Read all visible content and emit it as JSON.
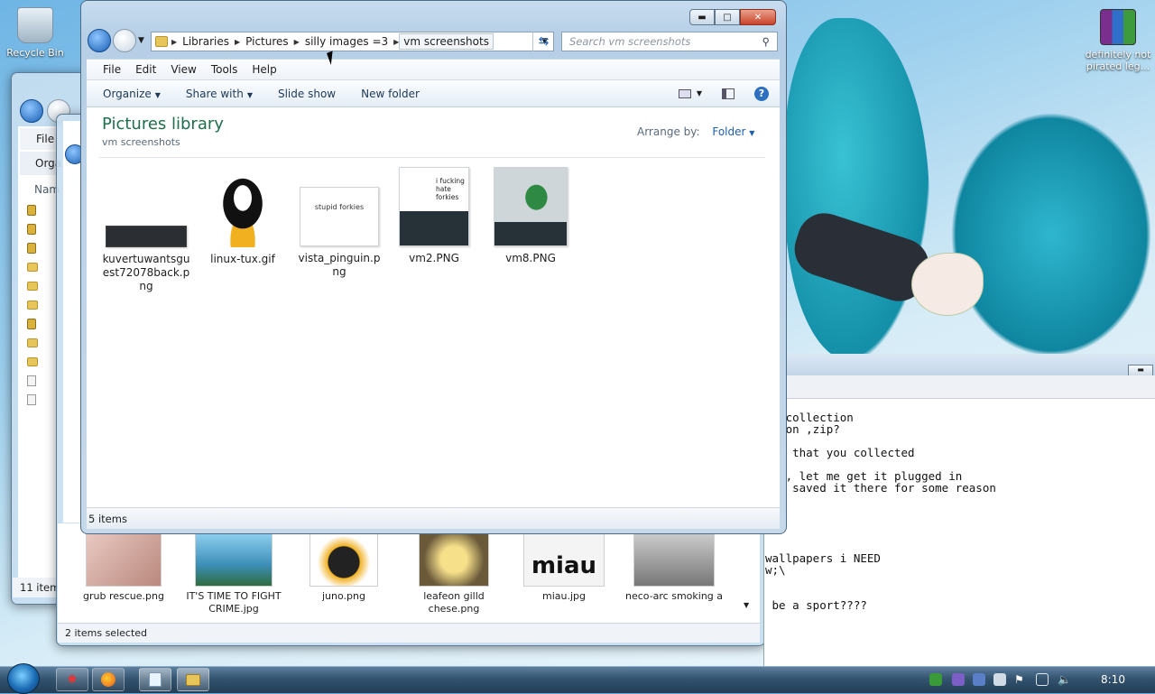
{
  "desktop": {
    "icons": [
      {
        "label": "Recycle Bin"
      },
      {
        "label": "definitely not pirated leg..."
      }
    ]
  },
  "front_window": {
    "breadcrumb": [
      "Libraries",
      "Pictures",
      "silly images =3",
      "vm screenshots"
    ],
    "search_placeholder": "Search vm screenshots",
    "menu": [
      "File",
      "Edit",
      "View",
      "Tools",
      "Help"
    ],
    "toolbar": [
      "Organize",
      "Share with",
      "Slide show",
      "New folder"
    ],
    "library_title": "Pictures library",
    "library_subtitle": "vm screenshots",
    "arrange_label": "Arrange by:",
    "arrange_value": "Folder",
    "files": [
      {
        "name": "kuvertuwantsguest72078back.png"
      },
      {
        "name": "linux-tux.gif"
      },
      {
        "name": "vista_pinguin.png"
      },
      {
        "name": "vm2.PNG",
        "thumb_text": "i fucking hate forkies"
      },
      {
        "name": "vm8.PNG"
      }
    ],
    "vista_thumb_text": "stupid forkies",
    "status": "5 items"
  },
  "back_window_1": {
    "menu_file": "File",
    "organize": "Orga",
    "name_header": "Nam",
    "status": "11 item"
  },
  "back_window_2": {
    "files": [
      {
        "name": "grub rescue.png"
      },
      {
        "name": "IT'S TIME TO FIGHT CRIME.jpg"
      },
      {
        "name": "juno.png"
      },
      {
        "name": "leafeon gilld chese.png"
      },
      {
        "name": "miau.jpg",
        "thumb_text": "miau"
      },
      {
        "name": "neco-arc smoking a"
      }
    ],
    "status": "2 items selected"
  },
  "text_window": {
    "lines": [
      " a collection",
      " tion ,zip?",
      "",
      " rs that you collected",
      "",
      " on, let me get it plugged in",
      " ne saved it there for some reason",
      "",
      "",
      "",
      "",
      "",
      "wallpapers i NEED",
      "w;\\",
      "",
      "",
      " be a sport????"
    ]
  },
  "taskbar": {
    "clock": "8:10"
  }
}
